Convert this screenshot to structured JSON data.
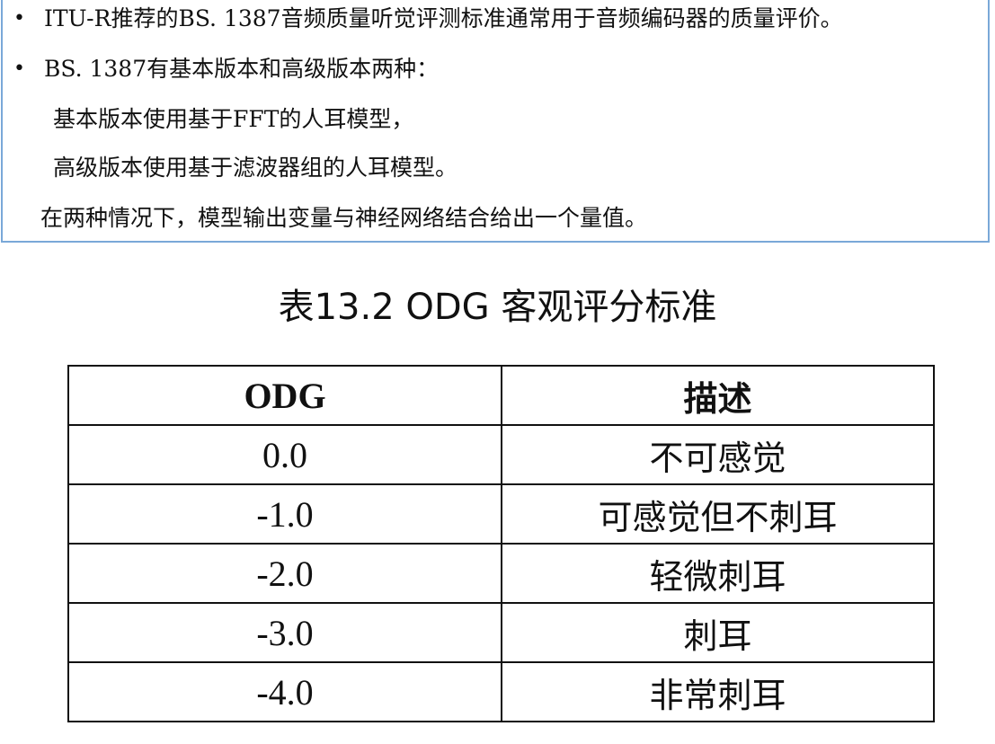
{
  "intro": {
    "bullet_glyph": "•",
    "lines": [
      "ITU-R推荐的BS. 1387音频质量听觉评测标准通常用于音频编码器的质量评价。",
      "BS. 1387有基本版本和高级版本两种：",
      "基本版本使用基于FFT的人耳模型，",
      "高级版本使用基于滤波器组的人耳模型。",
      "在两种情况下，模型输出变量与神经网络结合给出一个量值。"
    ]
  },
  "table": {
    "caption": "表13.2 ODG 客观评分标准",
    "headers": [
      "ODG",
      "描述"
    ],
    "rows": [
      [
        "0.0",
        "不可感觉"
      ],
      [
        "-1.0",
        "可感觉但不刺耳"
      ],
      [
        "-2.0",
        "轻微刺耳"
      ],
      [
        "-3.0",
        "刺耳"
      ],
      [
        "-4.0",
        "非常刺耳"
      ]
    ]
  },
  "colors": {
    "box_border": "#7aa8d8",
    "text": "#111111",
    "table_border": "#111111"
  }
}
